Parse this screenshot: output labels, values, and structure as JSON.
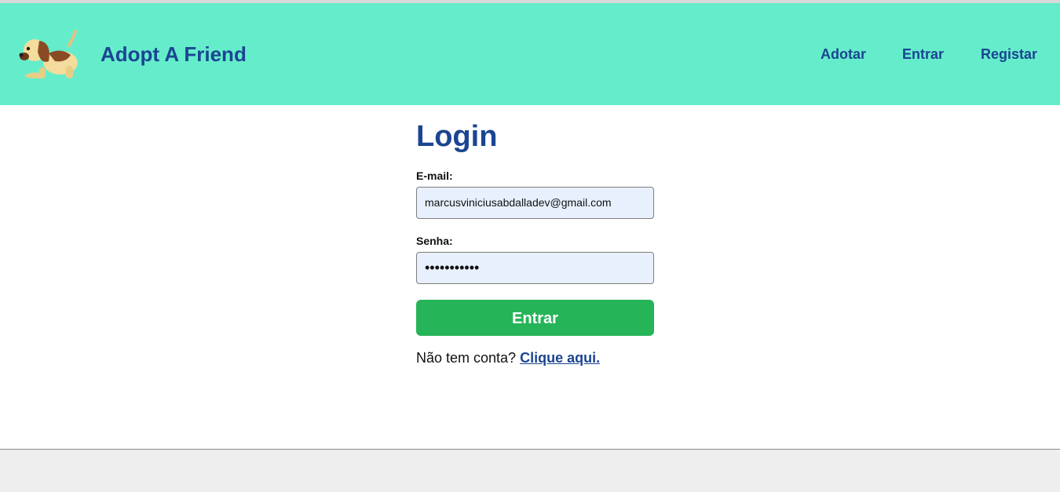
{
  "header": {
    "brand": "Adopt A Friend",
    "logo_icon": "dog-logo-icon",
    "nav": {
      "adotar": "Adotar",
      "entrar": "Entrar",
      "registar": "Registar"
    }
  },
  "login": {
    "title": "Login",
    "email_label": "E-mail:",
    "email_value": "marcusviniciusabdalladev@gmail.com",
    "password_label": "Senha:",
    "password_value": "•••••••••••",
    "submit_label": "Entrar",
    "register_prompt": "Não tem conta?",
    "register_link": "Clique aqui."
  },
  "colors": {
    "header_bg": "#65edcb",
    "brand_blue": "#1b4591",
    "button_green": "#26b458",
    "input_bg": "#e8f0fe"
  }
}
